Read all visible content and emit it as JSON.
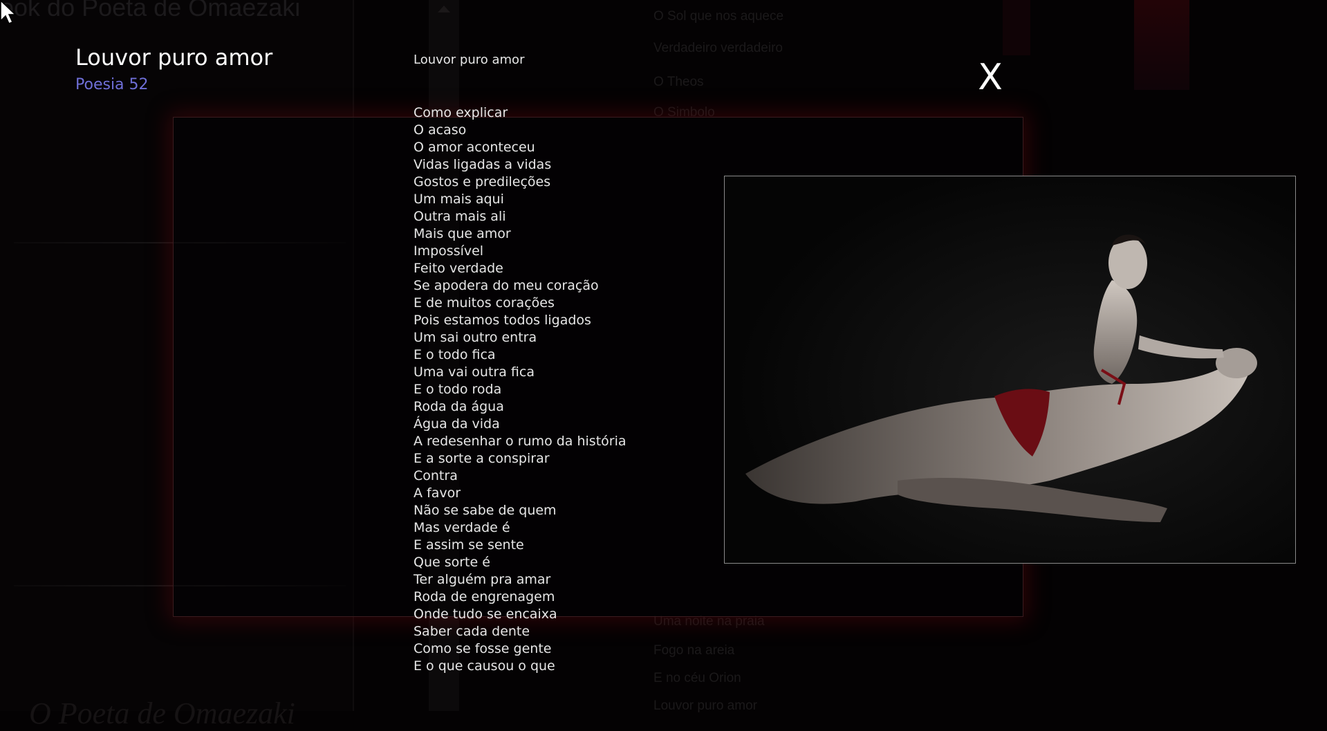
{
  "background": {
    "site_title": "ook do Poeta de Omaezaki",
    "links_top": [
      "O Sol que nos aquece",
      "Verdadeiro  verdadeiro",
      "O Theos",
      "O Simbolo"
    ],
    "links_bottom": [
      "Uma noite na praia",
      "Fogo na areia",
      "E no céu Orion",
      "Louvor puro amor"
    ],
    "footer_title": "O Poeta de Omaezaki"
  },
  "poem": {
    "title": "Louvor puro amor",
    "subtitle": "Poesia 52",
    "heading": "Louvor puro amor",
    "lines": [
      "Como explicar",
      "O acaso",
      "O amor aconteceu",
      "Vidas ligadas a vidas",
      "Gostos e predileções",
      "Um mais aqui",
      "Outra mais ali",
      "Mais que amor",
      "Impossível",
      "Feito verdade",
      "Se apodera do meu coração",
      "E de muitos corações",
      "Pois estamos todos ligados",
      "Um sai outro entra",
      "E o todo fica",
      "Uma vai outra fica",
      "E o todo roda",
      "Roda da água",
      "Água da vida",
      "A redesenhar o rumo da história",
      "E a sorte a conspirar",
      "Contra",
      "A favor",
      "Não se sabe de quem",
      "Mas verdade é",
      "E assim se sente",
      "Que sorte é",
      "Ter alguém pra amar",
      "Roda de engrenagem",
      "Onde tudo se encaixa",
      "Saber cada dente",
      "Como se fosse gente",
      "E o que causou o que"
    ]
  },
  "close_label": "X",
  "colors": {
    "background": "#040203",
    "subtitle": "#6f6fd8",
    "frame_glow": "#780a0f"
  }
}
